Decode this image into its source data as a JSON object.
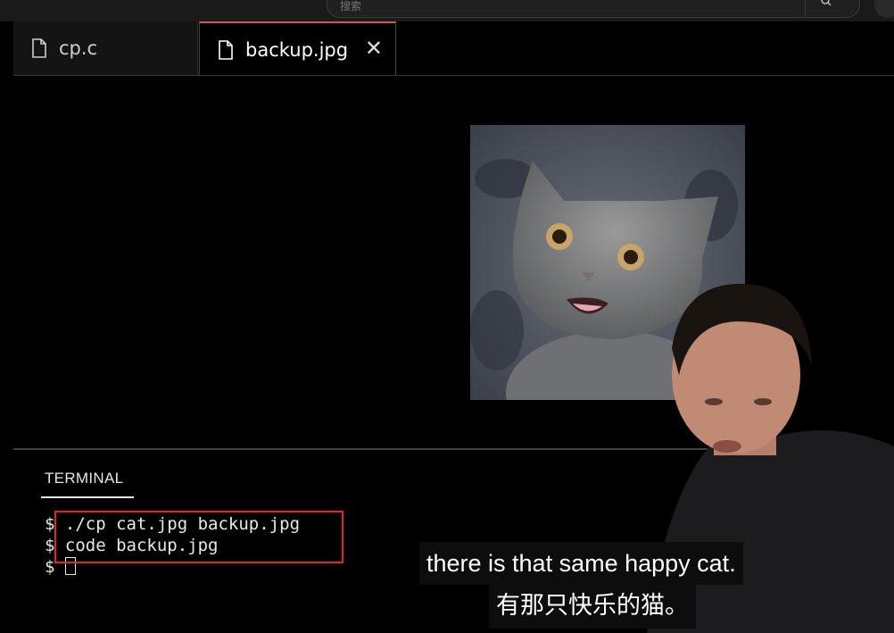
{
  "search": {
    "placeholder": "搜索"
  },
  "tabs": [
    {
      "label": "cp.c",
      "active": false
    },
    {
      "label": "backup.jpg",
      "active": true,
      "close_glyph": "✕"
    }
  ],
  "editor": {
    "image_description_icon": "cat-photo"
  },
  "panel": {
    "tab_label": "TERMINAL"
  },
  "terminal": {
    "prompt": "$",
    "lines": [
      "./cp cat.jpg backup.jpg",
      "code backup.jpg",
      ""
    ]
  },
  "subtitles": {
    "en": "there is that same happy cat.",
    "zh": "有那只快乐的猫。"
  },
  "colors": {
    "active_tab_accent": "#d9534f",
    "highlight_box": "#e3242b"
  }
}
